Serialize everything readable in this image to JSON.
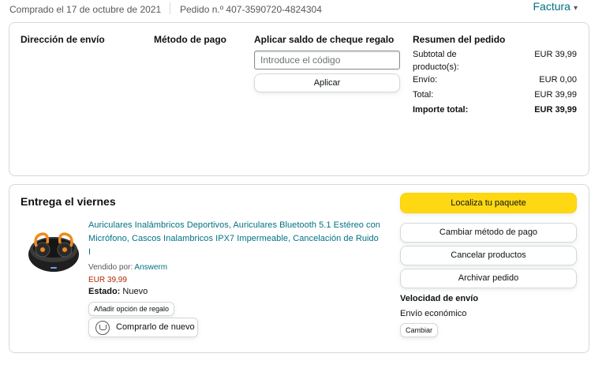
{
  "topbar": {
    "purchase_date": "Comprado el 17 de octubre de 2021",
    "order_number": "Pedido n.º 407-3590720-4824304",
    "invoice_label": "Factura"
  },
  "summary_box": {
    "shipping_address_header": "Dirección de envío",
    "payment_method_header": "Método de pago",
    "gift_card_header": "Aplicar saldo de cheque regalo",
    "gift_card_placeholder": "Introduce el código",
    "apply_button": "Aplicar",
    "order_summary_header": "Resumen del pedido",
    "rows": [
      {
        "label": "Subtotal de producto(s):",
        "value": "EUR 39,99"
      },
      {
        "label": "Envío:",
        "value": "EUR 0,00"
      },
      {
        "label": "Total:",
        "value": "EUR 39,99"
      },
      {
        "label": "Importe total:",
        "value": "EUR 39,99"
      }
    ]
  },
  "delivery": {
    "title": "Entrega el viernes",
    "product": {
      "title": "Auriculares Inalámbricos Deportivos, Auriculares Bluetooth 5.1 Estéreo con Micrófono, Cascos Inalambricos IPX7 Impermeable, Cancelación de Ruido I",
      "sold_by_label": "Vendido por:",
      "seller": "Answerm",
      "price": "EUR 39,99",
      "status_label": "Estado:",
      "status_value": "Nuevo",
      "gift_option_button": "Añadir opción de regalo",
      "buy_again_button": "Comprarlo de nuevo",
      "image_icon": "wireless-earbuds-image",
      "image_colors": {
        "case": "#2b2b2b",
        "accent": "#f08a1c"
      }
    },
    "actions": {
      "locate_package": "Localiza tu paquete",
      "change_payment": "Cambiar método de pago",
      "cancel_products": "Cancelar productos",
      "archive_order": "Archivar pedido"
    },
    "shipping_speed": {
      "header": "Velocidad de envío",
      "value": "Envío económico",
      "change_button": "Cambiar"
    }
  },
  "colors": {
    "link": "#007185",
    "price": "#b12704",
    "primary_button": "#ffd814",
    "border": "#d5d9d9"
  }
}
